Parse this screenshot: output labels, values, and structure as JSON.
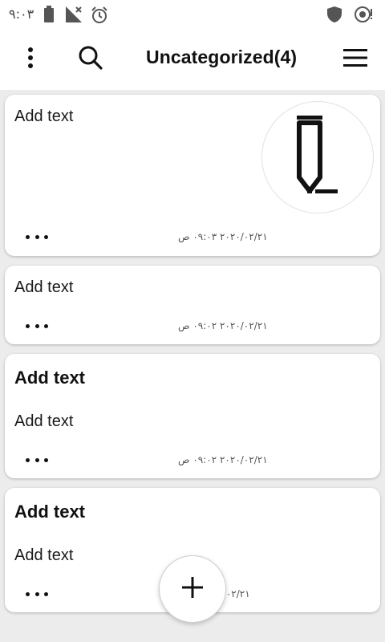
{
  "status_bar": {
    "time": "٩:٠٣",
    "icons": [
      "battery-icon",
      "no-signal-icon",
      "alarm-icon",
      "shield-icon",
      "sync-alert-icon"
    ]
  },
  "app_bar": {
    "title": "Uncategorized(4)",
    "icons": [
      "more-vert-icon",
      "search-icon",
      "menu-icon"
    ]
  },
  "notes": [
    {
      "title": "",
      "text": "Add text",
      "date": "٢٠٢٠/٠٢/٢١ ٠٩:٠٣ ص",
      "has_image": true,
      "image_icon": "pen-icon"
    },
    {
      "title": "",
      "text": "Add text",
      "date": "٢٠٢٠/٠٢/٢١ ٠٩:٠٢ ص",
      "has_image": false
    },
    {
      "title": "Add text",
      "text": "Add text",
      "date": "٢٠٢٠/٠٢/٢١ ٠٩:٠٢ ص",
      "has_image": false
    },
    {
      "title": "Add text",
      "text": "Add text",
      "date": "٢٠٢٠/٠٢/٢١",
      "has_image": false
    }
  ],
  "fab": {
    "icon": "plus-icon"
  }
}
